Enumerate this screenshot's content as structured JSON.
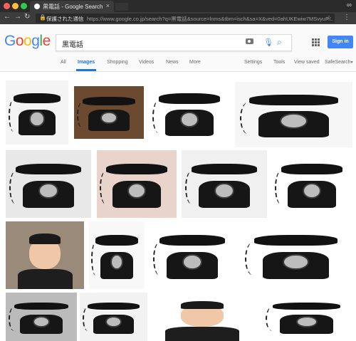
{
  "browser": {
    "tab_title": "黒電話 - Google Search",
    "tab_close": "×",
    "secure_label": "保護された通信",
    "url": "https://www.google.co.jp/search?q=黒電話&source=lnms&tbm=isch&sa=X&ved=0ahUKEwiw7MSvyuP...",
    "back_icon": "back-arrow-icon",
    "forward_icon": "forward-arrow-icon",
    "reload_icon": "reload-icon",
    "colors": {
      "close": "#fc605b",
      "minimize": "#fdbc40",
      "zoom": "#34c84a",
      "chrome_dark": "#2b2b2b"
    }
  },
  "google": {
    "logo_letters": [
      {
        "char": "G",
        "color": "#4285f4"
      },
      {
        "char": "o",
        "color": "#ea4335"
      },
      {
        "char": "o",
        "color": "#fbbc05"
      },
      {
        "char": "g",
        "color": "#4285f4"
      },
      {
        "char": "l",
        "color": "#34a853"
      },
      {
        "char": "e",
        "color": "#ea4335"
      }
    ],
    "query": "黒電話",
    "sign_in_label": "Sign in",
    "nav_tabs": [
      "All",
      "Images",
      "Shopping",
      "Videos",
      "News",
      "More"
    ],
    "active_tab": "Images",
    "tools": [
      "Settings",
      "Tools"
    ],
    "view_saved": "View saved",
    "safesearch": "SafeSearch"
  },
  "results": {
    "subjects": [
      "telephone",
      "telephone",
      "telephone",
      "telephone",
      "telephone",
      "telephone",
      "telephone",
      "telephone",
      "person",
      "telephone",
      "telephone",
      "telephone",
      "telephone",
      "telephone",
      "person",
      "telephone"
    ]
  }
}
